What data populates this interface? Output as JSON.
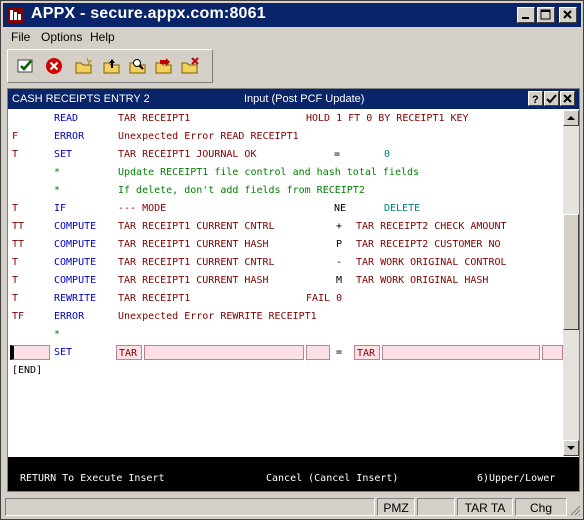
{
  "window": {
    "title": "APPX - secure.appx.com:8061"
  },
  "menu": [
    "File",
    "Options",
    "Help"
  ],
  "toolbar": {
    "icons": [
      "check-icon",
      "cancel-icon",
      "new-folder-icon",
      "folder-up-icon",
      "find-folder-icon",
      "folder-go-icon",
      "folder-x-icon"
    ]
  },
  "inner": {
    "title": "CASH RECEIPTS ENTRY 2",
    "mode": "Input (Post PCF Update)"
  },
  "code_rows": [
    {
      "flag": "",
      "cmd": "READ",
      "args": "TAR RECEIPT1",
      "extra1": "HOLD 1 FT 0 BY RECEIPT1 KEY"
    },
    {
      "flag": "F",
      "cmd": "ERROR",
      "args": "Unexpected Error READ RECEIPT1",
      "extra1": ""
    },
    {
      "flag": "T",
      "cmd": "SET",
      "args": "TAR RECEIPT1 JOURNAL OK",
      "op": "=",
      "extra1": "0"
    },
    {
      "flag": "",
      "cmd": "*",
      "args": "Update RECEIPT1 file control and hash total fields",
      "extra1": ""
    },
    {
      "flag": "",
      "cmd": "*",
      "args": "If delete, don't add fields from RECEIPT2",
      "extra1": ""
    },
    {
      "flag": "T",
      "cmd": "IF",
      "args": "--- MODE",
      "op": "NE",
      "extra1": "DELETE"
    },
    {
      "flag": "TT",
      "cmd": "COMPUTE",
      "args": "TAR RECEIPT1 CURRENT CNTRL",
      "op": "+",
      "extra1": "TAR RECEIPT2 CHECK AMOUNT"
    },
    {
      "flag": "TT",
      "cmd": "COMPUTE",
      "args": "TAR RECEIPT1 CURRENT HASH",
      "op": "P",
      "extra1": "TAR RECEIPT2 CUSTOMER NO"
    },
    {
      "flag": "T",
      "cmd": "COMPUTE",
      "args": "TAR RECEIPT1 CURRENT CNTRL",
      "op": "-",
      "extra1": "TAR WORK ORIGINAL CONTROL"
    },
    {
      "flag": "T",
      "cmd": "COMPUTE",
      "args": "TAR RECEIPT1 CURRENT HASH",
      "op": "M",
      "extra1": "TAR WORK ORIGINAL HASH"
    },
    {
      "flag": "T",
      "cmd": "REWRITE",
      "args": "TAR RECEIPT1",
      "extra1": "FAIL 0"
    },
    {
      "flag": "TF",
      "cmd": "ERROR",
      "args": "Unexpected Error REWRITE RECEIPT1",
      "extra1": ""
    },
    {
      "flag": "",
      "cmd": "*",
      "args": "",
      "extra1": ""
    }
  ],
  "edit_row": {
    "cmd": "SET",
    "app1": "TAR",
    "op": "=",
    "app2": "TAR"
  },
  "end_marker": "[END]",
  "hint": {
    "left": "RETURN To Execute Insert",
    "center": "Cancel (Cancel Insert)",
    "right": "6)Upper/Lower"
  },
  "status": {
    "pmz": "PMZ",
    "tarta": "TAR TA",
    "chg": "Chg"
  },
  "colors": {
    "title_bg": "#0a246a",
    "cmd": "#0000c0",
    "text": "#800000",
    "comment": "#008000",
    "teal": "#008080"
  }
}
